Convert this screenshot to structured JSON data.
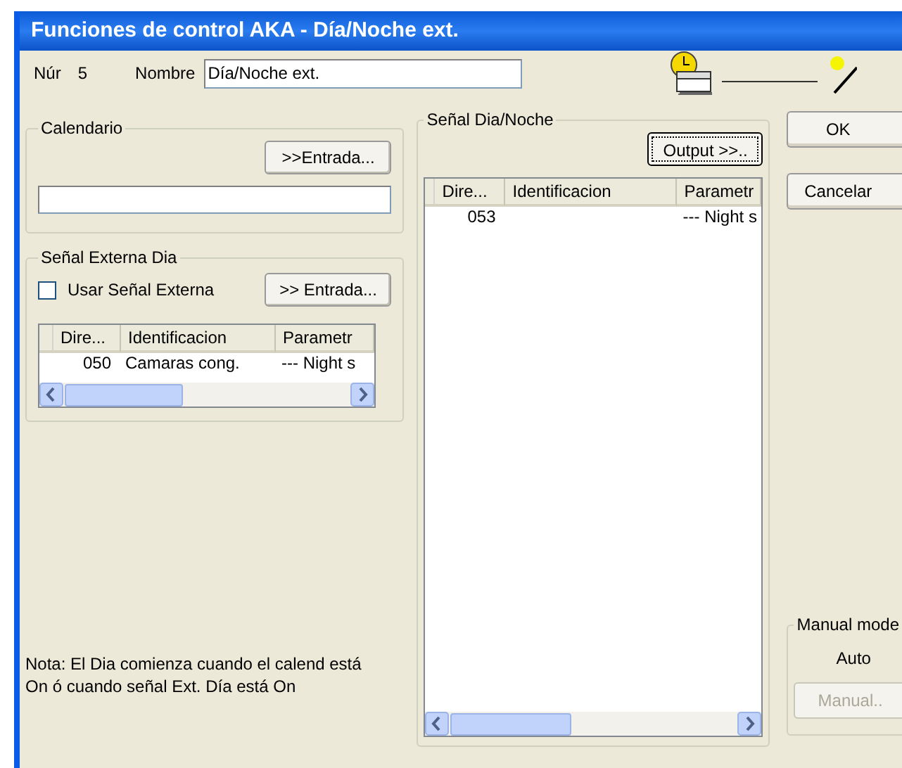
{
  "window": {
    "title": "Funciones de control AKA - Día/Noche ext."
  },
  "number": {
    "label": "Núr",
    "value": "5"
  },
  "name": {
    "label": "Nombre",
    "value": "Día/Noche ext."
  },
  "calendar": {
    "title": "Calendario",
    "button": ">>Entrada..."
  },
  "external_signal": {
    "title": "Señal Externa Dia",
    "checkbox": {
      "label": "Usar Señal Externa",
      "checked": false
    },
    "button": ">> Entrada...",
    "table": {
      "columns": [
        "Dire...",
        "Identificacion",
        "Parametr"
      ],
      "rows": [
        {
          "dire": "050",
          "identificacion": "Camaras cong.",
          "parametr": "--- Night s"
        }
      ]
    }
  },
  "day_night_signal": {
    "title": "Señal Dia/Noche",
    "button": {
      "label": "Output >>..",
      "focused": true
    },
    "table": {
      "columns": [
        "Dire...",
        "Identificacion",
        "Parametr"
      ],
      "rows": [
        {
          "dire": "053",
          "parametr": "--- Night s"
        }
      ]
    }
  },
  "note": "Nota: El Dia comienza cuando el calend está On ó cuando señal Ext. Día está On",
  "buttons": [
    {
      "label": "OK"
    },
    {
      "label": "Cancelar"
    }
  ],
  "manual_mode": {
    "title": "Manual mode",
    "status": "Auto",
    "button": {
      "label": "Manual..",
      "disabled": true
    }
  }
}
